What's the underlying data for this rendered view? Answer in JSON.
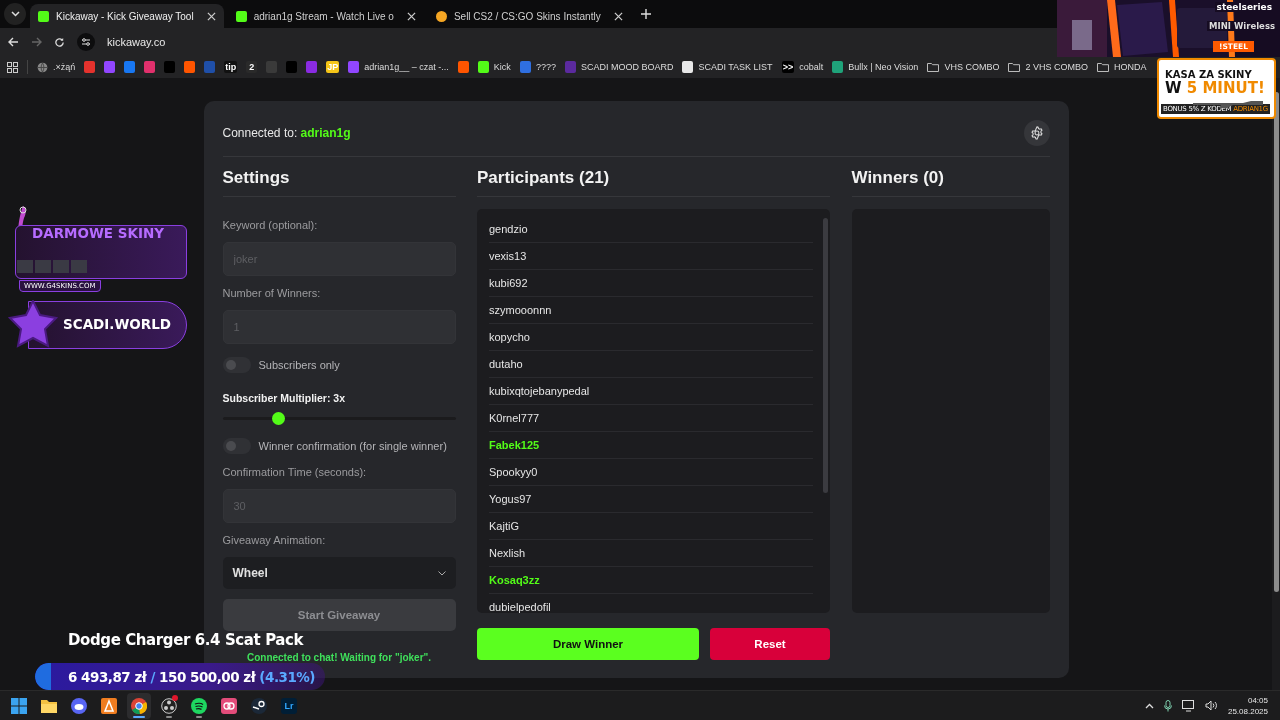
{
  "browser": {
    "tabs": [
      {
        "title": "Kickaway - Kick Giveaway Tool",
        "selected": true,
        "color": "#53fc18"
      },
      {
        "title": "adrian1g Stream - Watch Live o",
        "selected": false,
        "color": "#53fc18"
      },
      {
        "title": "Sell CS2 / CS:GO Skins Instantly",
        "selected": false,
        "color": "#f5a623"
      }
    ],
    "address": "kickaway.co",
    "bookmarks": [
      {
        "kind": "globe",
        "label": ".×żąń"
      },
      {
        "kind": "site",
        "color": "#e5322d"
      },
      {
        "kind": "site",
        "color": "#9146ff"
      },
      {
        "kind": "site",
        "color": "#1877f2"
      },
      {
        "kind": "site",
        "color": "#e1306c"
      },
      {
        "kind": "site",
        "color": "#000000"
      },
      {
        "kind": "site",
        "color": "#ff5500"
      },
      {
        "kind": "site",
        "color": "#1f4fa8"
      },
      {
        "kind": "site",
        "color": "#111111",
        "glyph": "tip"
      },
      {
        "kind": "site",
        "color": "#2a2a2a",
        "glyph": "2"
      },
      {
        "kind": "site",
        "color": "#3a3a3a"
      },
      {
        "kind": "site",
        "color": "#000000"
      },
      {
        "kind": "site",
        "color": "#8a2be2"
      },
      {
        "kind": "site",
        "color": "#f5c518",
        "glyph": "JP"
      },
      {
        "kind": "site",
        "color": "#9146ff",
        "label": "adrian1g__ – czat -..."
      },
      {
        "kind": "site",
        "color": "#ff5500"
      },
      {
        "kind": "site",
        "color": "#53fc18",
        "label": "Kick"
      },
      {
        "kind": "site",
        "color": "#2f6fe0",
        "label": "????"
      },
      {
        "kind": "site",
        "color": "#5b2a9e",
        "label": "SCADI MOOD BOARD"
      },
      {
        "kind": "site",
        "color": "#e8e8e8",
        "label": "SCADI TASK LIST"
      },
      {
        "kind": "site",
        "color": "#000000",
        "glyph": ">>",
        "label": "cobalt"
      },
      {
        "kind": "site",
        "color": "#1fa37a",
        "label": "Bullx | Neo Vision"
      },
      {
        "kind": "folder",
        "label": "VHS COMBO"
      },
      {
        "kind": "folder",
        "label": "2 VHS COMBO"
      },
      {
        "kind": "folder",
        "label": "HONDA"
      }
    ]
  },
  "app": {
    "connected_label": "Connected to:",
    "channel": "adrian1g",
    "settings": {
      "title": "Settings",
      "items": [
        {
          "kind": "input",
          "label": "Keyword (optional):",
          "placeholder": "joker"
        },
        {
          "kind": "input",
          "label": "Number of Winners:",
          "placeholder": "1"
        },
        {
          "kind": "toggle",
          "label": "Subscribers only",
          "on": false
        },
        {
          "kind": "slider",
          "label": "Subscriber Multiplier: 3x",
          "level": 0.24
        },
        {
          "kind": "toggle",
          "label": "Winner confirmation (for single winner)",
          "on": false
        },
        {
          "kind": "input",
          "label": "Confirmation Time (seconds):",
          "placeholder": "30"
        },
        {
          "kind": "select",
          "label": "Giveaway Animation:",
          "value": "Wheel"
        },
        {
          "kind": "button",
          "label": "Start Giveaway",
          "disabled": true
        }
      ],
      "status": "Connected to chat! Waiting for \"joker\"."
    },
    "participants": {
      "title": "Participants (21)",
      "names": [
        {
          "name": "gendzio",
          "highlighted": false
        },
        {
          "name": "vexis13",
          "highlighted": false
        },
        {
          "name": "kubi692",
          "highlighted": false
        },
        {
          "name": "szymooonnn",
          "highlighted": false
        },
        {
          "name": "kopycho",
          "highlighted": false
        },
        {
          "name": "dutaho",
          "highlighted": false
        },
        {
          "name": "kubixqtojebanypedal",
          "highlighted": false
        },
        {
          "name": "K0rnel777",
          "highlighted": false
        },
        {
          "name": "Fabek125",
          "highlighted": true
        },
        {
          "name": "Spookyy0",
          "highlighted": false
        },
        {
          "name": "Yogus97",
          "highlighted": false
        },
        {
          "name": "KajtiG",
          "highlighted": false
        },
        {
          "name": "Nexlish",
          "highlighted": false
        },
        {
          "name": "Kosaq3zz",
          "highlighted": true
        },
        {
          "name": "dubielpedofil",
          "highlighted": false
        }
      ],
      "buttons": [
        {
          "label": "Draw Winner",
          "kind": "primary"
        },
        {
          "label": "Reset",
          "kind": "danger"
        }
      ]
    },
    "winners": {
      "title": "Winners (0)"
    }
  },
  "overlays": {
    "steel_ad": {
      "brand": "steelseries",
      "product": "MINI Wireless",
      "code": "!STEEL"
    },
    "skins_ad": {
      "headline": "KASA ZA SKINY",
      "big_text": "W",
      "big_highlight": "5 MINUT!",
      "bonus": "BONUS 5% Z KODEM",
      "code": "ADRIAN1G"
    },
    "promo_banners": [
      {
        "kind": "skins",
        "title": "DARMOWE SKINY",
        "url": "WWW.G4SKINS.COM"
      },
      {
        "kind": "world",
        "title": "SCADI.WORLD"
      }
    ],
    "goal": {
      "title": "Dodge Charger 6.4 Scat Pack",
      "current": "6 493,87 zł",
      "separator": "/",
      "target": "150 500,00 zł",
      "percent": "(4.31%)",
      "level": 0.0431
    }
  },
  "taskbar": {
    "apps": [
      {
        "kind": "start",
        "active": false,
        "running": false
      },
      {
        "kind": "folder",
        "active": false,
        "running": false
      },
      {
        "kind": "chat",
        "active": false,
        "running": false
      },
      {
        "kind": "triangle",
        "active": false,
        "running": false
      },
      {
        "kind": "browser",
        "active": true,
        "running": true
      },
      {
        "kind": "recorder",
        "active": false,
        "running": true,
        "notification": true
      },
      {
        "kind": "music",
        "active": false,
        "running": true
      },
      {
        "kind": "cloud",
        "active": false,
        "running": false
      },
      {
        "kind": "steam",
        "active": false,
        "running": false
      },
      {
        "active": false,
        "running": false,
        "glyph": "Lr"
      }
    ],
    "time": "04:05",
    "date": "25.08.2025"
  }
}
